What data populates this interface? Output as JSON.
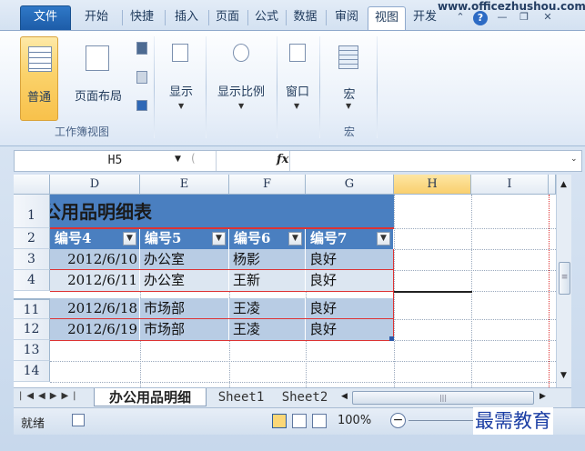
{
  "tabs": [
    "文件",
    "开始",
    "快捷",
    "插入",
    "页面",
    "公式",
    "数据",
    "审阅",
    "视图",
    "开发"
  ],
  "active_tab": "视图",
  "site": "www.officezhushou.com",
  "ribbon": {
    "normal": "普通",
    "page_layout": "页面布局",
    "show": "显示",
    "zoom": "显示比例",
    "window": "窗口",
    "macro": "宏",
    "group_workbook_views": "工作簿视图",
    "group_macro": "宏"
  },
  "formula_bar": {
    "name_box": "H5",
    "fx": "fx",
    "value": ""
  },
  "columns": [
    "D",
    "E",
    "F",
    "G",
    "H",
    "I"
  ],
  "rows": [
    "1",
    "2",
    "3",
    "4",
    "11",
    "12",
    "13",
    "14"
  ],
  "title": "公用品明细表",
  "headers": [
    "编号4",
    "编号5",
    "编号6",
    "编号7"
  ],
  "data": [
    [
      "2012/6/10",
      "办公室",
      "杨影",
      "良好"
    ],
    [
      "2012/6/11",
      "办公室",
      "王新",
      "良好"
    ],
    [
      "2012/6/18",
      "市场部",
      "王凌",
      "良好"
    ],
    [
      "2012/6/19",
      "市场部",
      "王凌",
      "良好"
    ]
  ],
  "sheets": [
    "办公用品明细",
    "Sheet1",
    "Sheet2"
  ],
  "status": {
    "ready": "就绪",
    "zoom": "100%"
  },
  "watermark": "最需教育"
}
